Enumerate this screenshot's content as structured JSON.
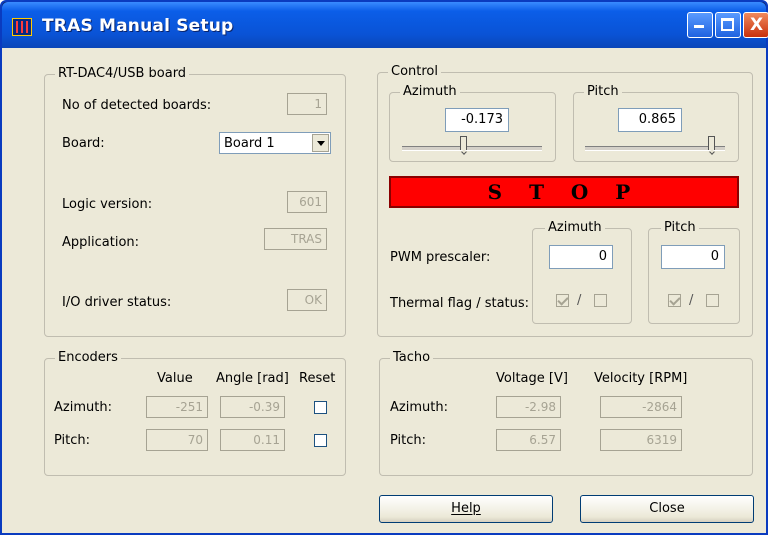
{
  "window": {
    "title": "TRAS Manual Setup",
    "minimize": "_",
    "maximize": "□",
    "close": "X"
  },
  "board": {
    "group_label": "RT-DAC4/USB board",
    "detected_label": "No of detected boards:",
    "detected_value": "1",
    "board_label": "Board:",
    "board_value": "Board 1",
    "logic_label": "Logic version:",
    "logic_value": "601",
    "application_label": "Application:",
    "application_value": "TRAS",
    "driver_label": "I/O driver status:",
    "driver_value": "OK"
  },
  "control": {
    "group_label": "Control",
    "azimuth_label": "Azimuth",
    "azimuth_value": "-0.173",
    "pitch_label": "Pitch",
    "pitch_value": "0.865",
    "stop_label": "S T O P",
    "pwm_azimuth_label": "Azimuth",
    "pwm_pitch_label": "Pitch",
    "pwm_label": "PWM prescaler:",
    "pwm_azimuth_value": "0",
    "pwm_pitch_value": "0",
    "thermal_label": "Thermal flag / status:",
    "thermal_sep": "/"
  },
  "encoders": {
    "group_label": "Encoders",
    "col_value": "Value",
    "col_angle": "Angle [rad]",
    "col_reset": "Reset",
    "rows": [
      {
        "label": "Azimuth:",
        "value": "-251",
        "angle": "-0.39"
      },
      {
        "label": "Pitch:",
        "value": "70",
        "angle": "0.11"
      }
    ]
  },
  "tacho": {
    "group_label": "Tacho",
    "col_voltage": "Voltage [V]",
    "col_velocity": "Velocity [RPM]",
    "rows": [
      {
        "label": "Azimuth:",
        "voltage": "-2.98",
        "velocity": "-2864"
      },
      {
        "label": "Pitch:",
        "voltage": "6.57",
        "velocity": "6319"
      }
    ]
  },
  "buttons": {
    "help": "Help",
    "close": "Close"
  },
  "colors": {
    "stop": "#ff0000",
    "titlebar": "#0a53d6",
    "dialog": "#ece9d8"
  }
}
